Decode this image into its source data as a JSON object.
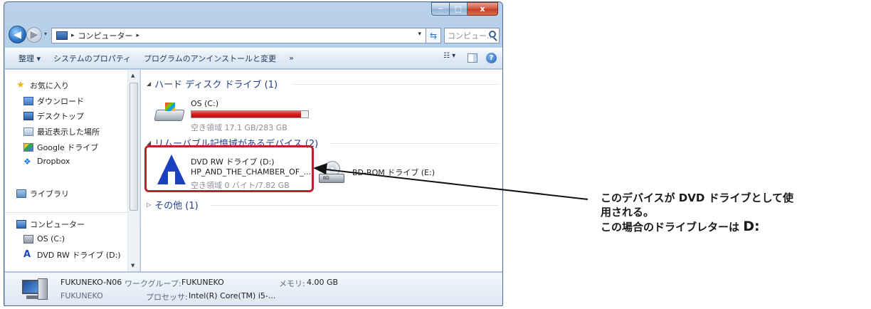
{
  "window": {
    "caption": {
      "minimize": "─",
      "maximize": "□",
      "close": "x"
    }
  },
  "address": {
    "path": "コンピューター",
    "search_placeholder": "コンピュー..."
  },
  "command_bar": {
    "organize": "整理 ▾",
    "system_properties": "システムのプロパティ",
    "uninstall": "プログラムのアンインストールと変更",
    "more": "»"
  },
  "nav": {
    "favorites": "お気に入り",
    "downloads": "ダウンロード",
    "desktop": "デスクトップ",
    "recent": "最近表示した場所",
    "google_drive": "Google ドライブ",
    "dropbox": "Dropbox",
    "libraries": "ライブラリ",
    "computer": "コンピューター",
    "os_drive": "OS (C:)",
    "dvd_drive": "DVD RW ドライブ (D:)"
  },
  "groups": {
    "hard_disk": "ハード ディスク ドライブ (1)",
    "removable": "リムーバブル記憶域があるデバイス (2)",
    "other": "その他 (1)"
  },
  "drives": {
    "os": {
      "name": "OS (C:)",
      "free": "空き領域 17.1 GB/283 GB",
      "used_fraction": 0.94
    },
    "dvd": {
      "name": "DVD RW ドライブ (D:)",
      "volume": "HP_AND_THE_CHAMBER_OF_...",
      "free": "空き領域 0 バイト/7.82 GB"
    },
    "bd": {
      "name": "BD-ROM ドライブ (E:)",
      "badge": "BD"
    }
  },
  "details": {
    "computer_name": "FUKUNEKO-N06",
    "workgroup_label": "ワークグループ:",
    "workgroup_value": "FUKUNEKO",
    "memory_label": "メモリ:",
    "memory_value": "4.00 GB",
    "domain": "FUKUNEKO",
    "processor_label": "プロセッサ:",
    "processor_value": "Intel(R) Core(TM) i5-..."
  },
  "annotation": {
    "line1": "このデバイスが DVD ドライブとして使",
    "line2": "用される。",
    "line3_prefix": "この場合のドライブレターは",
    "line3_letter": "D:"
  },
  "colors": {
    "selection": "#c0202a",
    "usage_bar": "#d91c1c",
    "group_header": "#1e3e8f"
  }
}
